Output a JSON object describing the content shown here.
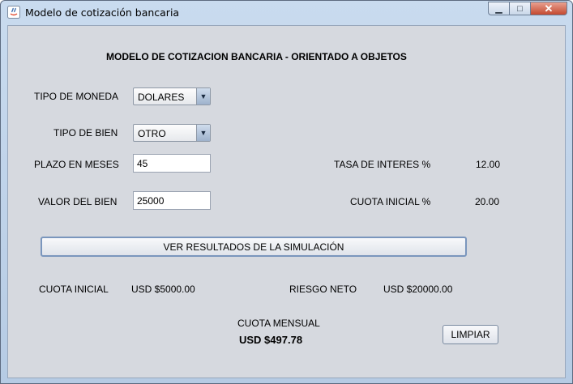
{
  "window": {
    "title": "Modelo de cotización bancaria"
  },
  "form": {
    "heading": "MODELO DE COTIZACION BANCARIA - ORIENTADO A OBJETOS",
    "moneda_label": "TIPO DE MONEDA",
    "moneda_value": "DOLARES",
    "bien_label": "TIPO DE BIEN",
    "bien_value": "OTRO",
    "plazo_label": "PLAZO EN MESES",
    "plazo_value": "45",
    "valor_label": "VALOR DEL BIEN",
    "valor_value": "25000",
    "tasa_label": "TASA DE INTERES %",
    "tasa_value": "12.00",
    "cuota_inicial_pct_label": "CUOTA INICIAL %",
    "cuota_inicial_pct_value": "20.00",
    "simulate_button": "VER RESULTADOS DE LA SIMULACIÓN"
  },
  "results": {
    "cuota_inicial_label": "CUOTA INICIAL",
    "cuota_inicial_value": "USD $5000.00",
    "riesgo_label": "RIESGO NETO",
    "riesgo_value": "USD $20000.00",
    "cuota_mensual_label": "CUOTA MENSUAL",
    "cuota_mensual_value": "USD $497.78",
    "clear_button": "LIMPIAR"
  }
}
